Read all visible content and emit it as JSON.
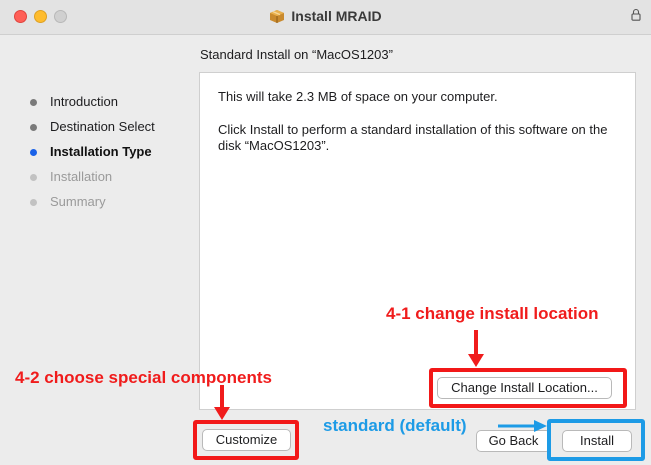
{
  "window": {
    "title": "Install MRAID",
    "subtitle": "Standard Install on “MacOS1203”"
  },
  "steps": [
    {
      "label": "Introduction",
      "state": "done"
    },
    {
      "label": "Destination Select",
      "state": "done"
    },
    {
      "label": "Installation Type",
      "state": "current"
    },
    {
      "label": "Installation",
      "state": "future"
    },
    {
      "label": "Summary",
      "state": "future"
    }
  ],
  "content": {
    "line1": "This will take 2.3 MB of space on your computer.",
    "line2": "Click Install to perform a standard installation of this software on the disk “MacOS1203”."
  },
  "buttons": {
    "change_location": "Change Install Location...",
    "customize": "Customize",
    "go_back": "Go Back",
    "install": "Install"
  },
  "annotations": {
    "change_location": "4-1 change install location",
    "customize": "4-2 choose special components",
    "standard": "standard (default)"
  },
  "colors": {
    "annotation_red": "#f01c1c",
    "annotation_blue": "#1d9be6",
    "current_step": "#1a62e8"
  },
  "icons": [
    "package-icon",
    "lock-icon"
  ]
}
